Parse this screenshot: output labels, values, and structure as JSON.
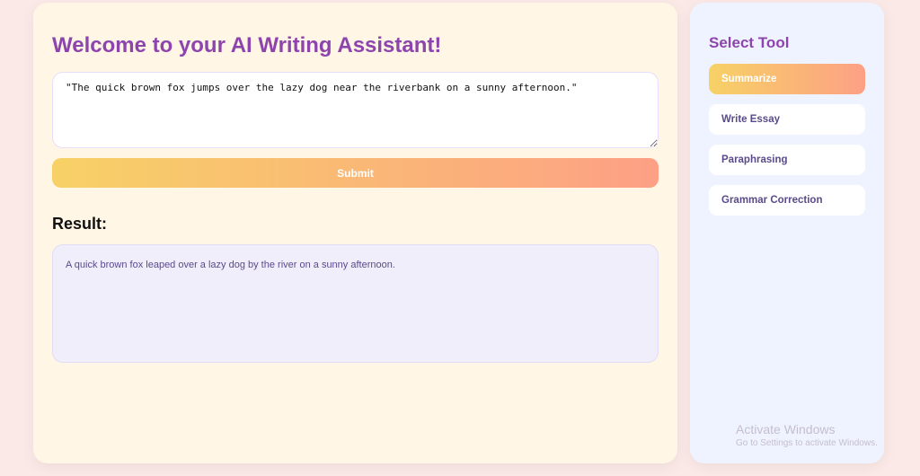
{
  "main": {
    "title": "Welcome to your AI Writing Assistant!",
    "input_value": "\"The quick brown fox jumps over the lazy dog near the riverbank on a sunny afternoon.\"",
    "submit_label": "Submit",
    "result_heading": "Result:",
    "result_text": "A quick brown fox leaped over a lazy dog by the river on a sunny afternoon."
  },
  "sidebar": {
    "title": "Select Tool",
    "tools": [
      {
        "label": "Summarize",
        "active": true
      },
      {
        "label": "Write Essay"
      },
      {
        "label": "Paraphrasing"
      },
      {
        "label": "Grammar Correction"
      }
    ]
  },
  "watermark": {
    "line1": "Activate Windows",
    "line2": "Go to Settings to activate Windows."
  }
}
